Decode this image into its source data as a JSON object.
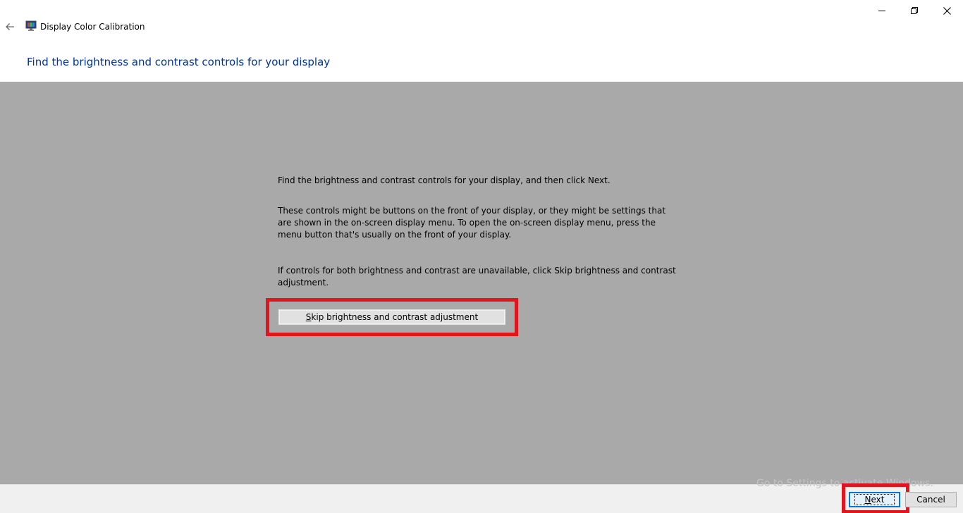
{
  "titlebar": {
    "back_icon": "back-arrow-icon",
    "app_icon": "display-calibration-icon",
    "title": "Display Color Calibration",
    "minimize_icon": "minimize-icon",
    "restore_icon": "restore-icon",
    "close_icon": "close-icon"
  },
  "header": {
    "heading": "Find the brightness and contrast controls for your display",
    "heading_color": "#003399"
  },
  "content": {
    "background": "#a9a9a9",
    "paragraph1": "Find the brightness and contrast controls for your display, and then click Next.",
    "paragraph2": "These controls might be buttons on the front of your display, or they might be settings that are shown in the on-screen display menu. To open the on-screen display menu, press the menu button that's usually on the front of your display.",
    "paragraph3": "If controls for both brightness and contrast are unavailable, click Skip brightness and contrast adjustment.",
    "skip_button": {
      "access_key": "S",
      "label_rest": "kip brightness and contrast adjustment"
    }
  },
  "footer": {
    "watermark": "Go to Settings to activate Windows.",
    "next_button": {
      "access_key": "N",
      "label_rest": "ext"
    },
    "cancel_label": "Cancel"
  },
  "highlight_color": "#e0161f"
}
